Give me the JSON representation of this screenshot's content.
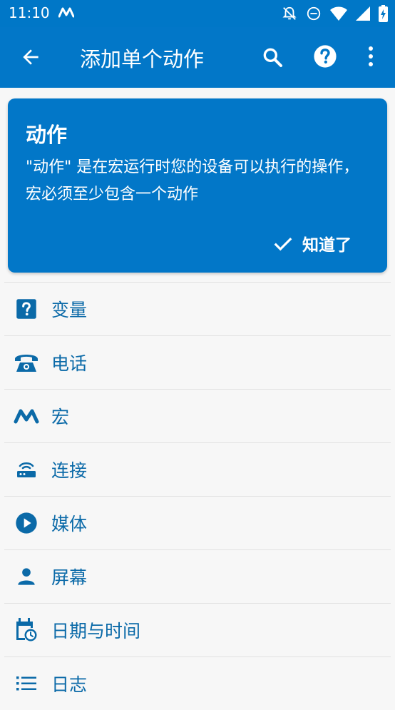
{
  "status": {
    "time": "11:10"
  },
  "appbar": {
    "title": "添加单个动作"
  },
  "tip": {
    "heading": "动作",
    "body": "\"动作\" 是在宏运行时您的设备可以执行的操作，宏必须至少包含一个动作",
    "ok_label": "知道了"
  },
  "categories": [
    {
      "label": "变量",
      "icon": "question-box-icon"
    },
    {
      "label": "电话",
      "icon": "phone-icon"
    },
    {
      "label": "宏",
      "icon": "macro-m-icon"
    },
    {
      "label": "连接",
      "icon": "router-icon"
    },
    {
      "label": "媒体",
      "icon": "play-circle-icon"
    },
    {
      "label": "屏幕",
      "icon": "person-icon"
    },
    {
      "label": "日期与时间",
      "icon": "calendar-clock-icon"
    },
    {
      "label": "日志",
      "icon": "list-icon"
    }
  ],
  "colors": {
    "primary": "#0277c8",
    "icon": "#0b6aa8",
    "background": "#f7f7f7"
  }
}
